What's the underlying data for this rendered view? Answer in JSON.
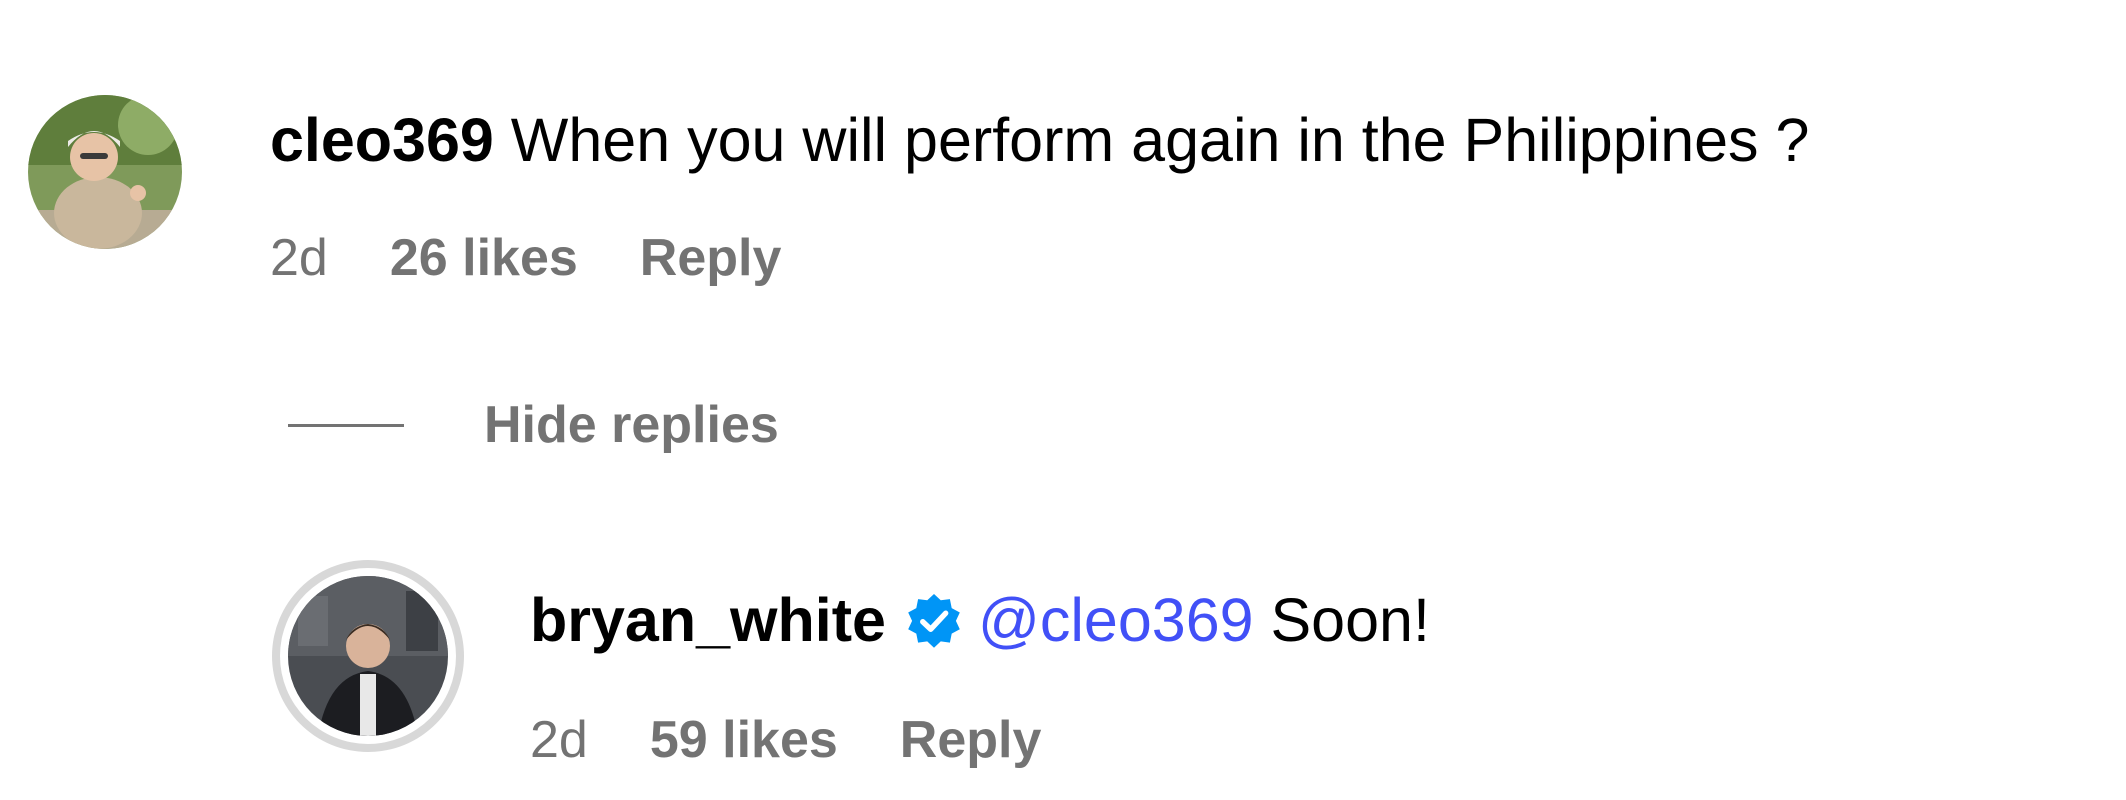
{
  "comment": {
    "username": "cleo369",
    "text": "When you will perform again in the Philippines ?",
    "time": "2d",
    "likes": "26 likes",
    "reply_label": "Reply"
  },
  "hide_replies_label": "Hide replies",
  "reply": {
    "username": "bryan_white",
    "verified": true,
    "mention": "@cleo369",
    "text": "Soon!",
    "time": "2d",
    "likes": "59 likes",
    "reply_label": "Reply"
  },
  "colors": {
    "text": "#000000",
    "secondary": "#737373",
    "mention": "#4150f7",
    "verified_badge": "#0095f6"
  }
}
